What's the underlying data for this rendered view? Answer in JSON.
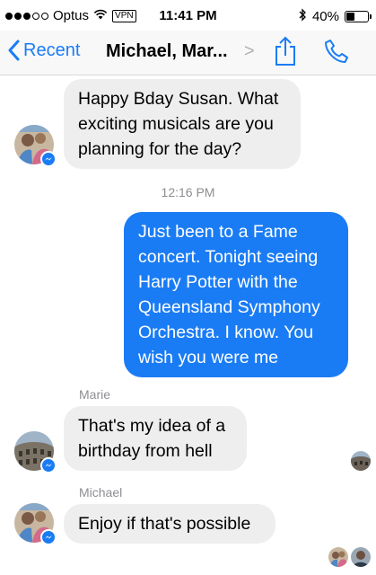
{
  "status_bar": {
    "carrier": "Optus",
    "vpn": "VPN",
    "time": "11:41 PM",
    "battery": "40%",
    "battery_level": 0.4
  },
  "nav": {
    "back_label": "Recent",
    "title": "Michael, Mar..."
  },
  "messages": {
    "m1_text": "Happy Bday Susan. What exciting musicals are you planning for the day?",
    "timestamp": "12:16 PM",
    "m2_text": "Just been to a Fame concert. Tonight seeing Harry Potter with the Queensland Symphony Orchestra. I know. You wish you were me",
    "m3_sender": "Marie",
    "m3_text": "That's my idea of a birthday from hell",
    "m4_sender": "Michael",
    "m4_text": "Enjoy if that's possible"
  },
  "colors": {
    "accent": "#1a7cf5",
    "incoming_bubble": "#eeeeef",
    "meta_text": "#8e8e93"
  },
  "icons": [
    "wifi-icon",
    "bluetooth-icon",
    "battery-icon",
    "back-chevron-icon",
    "share-icon",
    "phone-icon",
    "messenger-badge-icon"
  ]
}
